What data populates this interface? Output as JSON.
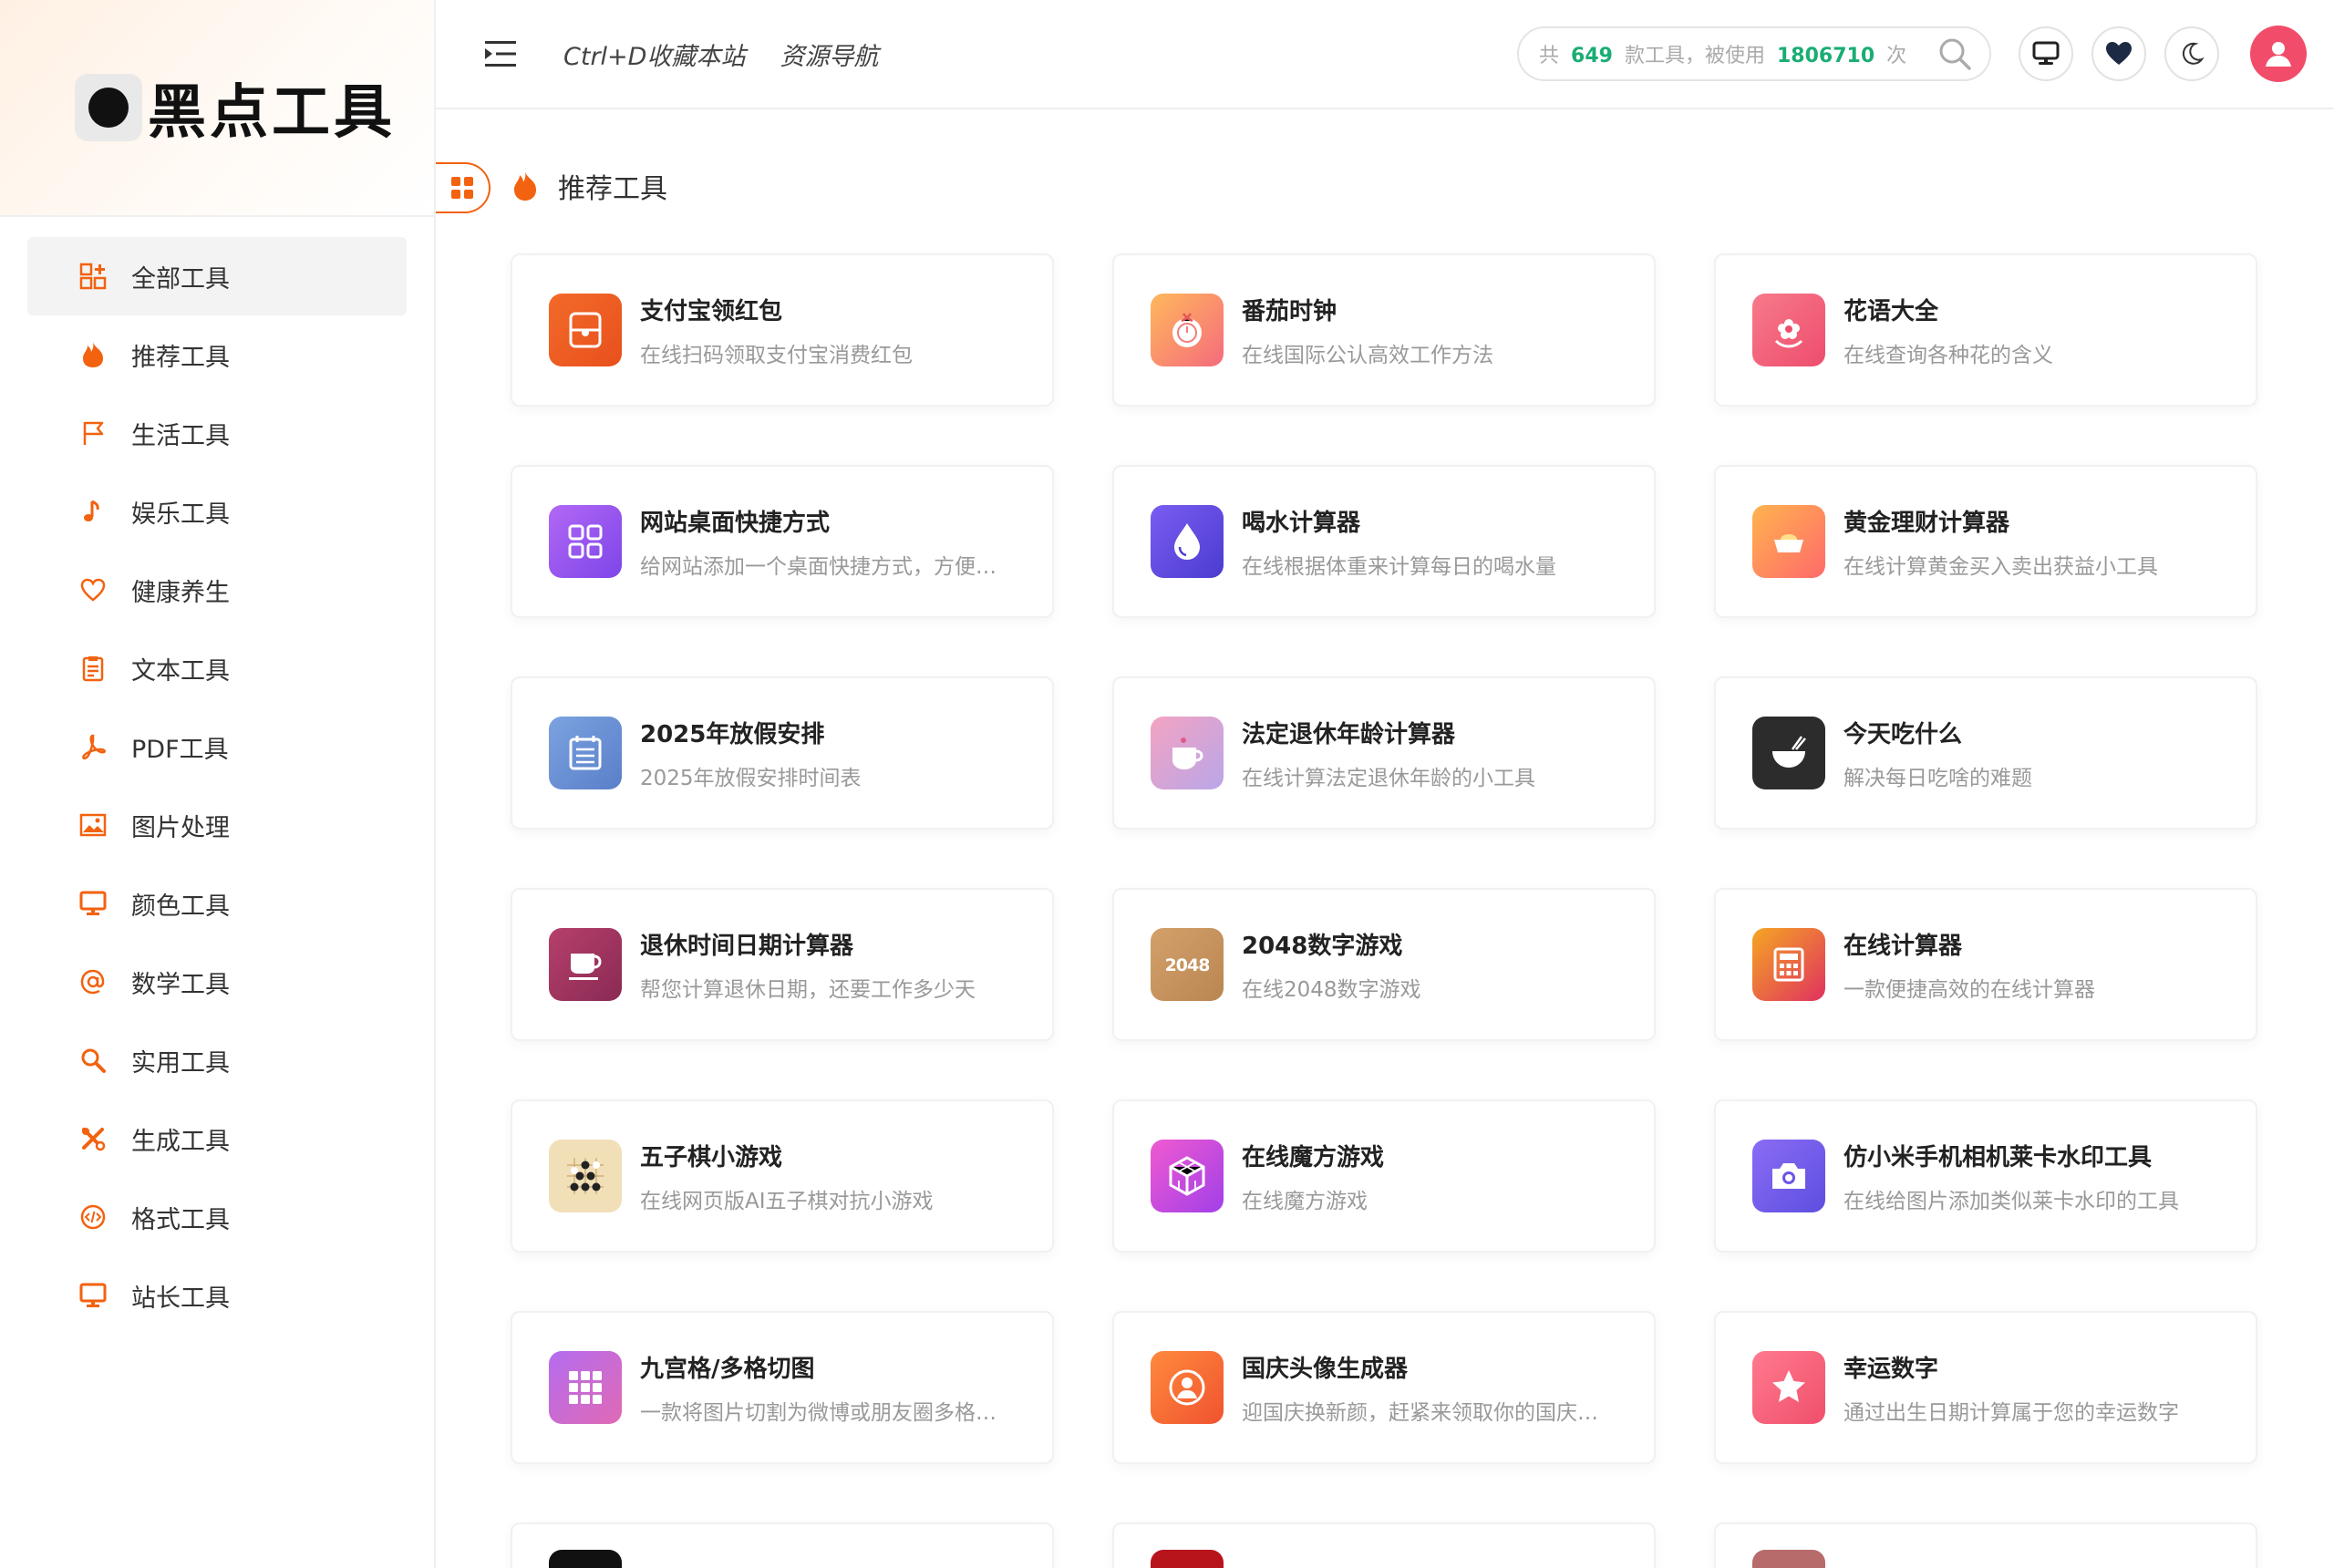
{
  "brand": {
    "name": "黑点工具"
  },
  "header": {
    "bookmark_hint": "Ctrl+D收藏本站",
    "resource_nav": "资源导航",
    "stats": {
      "prefix": "共",
      "tool_count": "649",
      "middle": "款工具，被使用",
      "use_count": "1806710",
      "suffix": "次"
    }
  },
  "sidebar": {
    "items": [
      {
        "label": "全部工具",
        "icon": "grid-plus-icon"
      },
      {
        "label": "推荐工具",
        "icon": "fire-icon"
      },
      {
        "label": "生活工具",
        "icon": "flag-icon"
      },
      {
        "label": "娱乐工具",
        "icon": "music-note-icon"
      },
      {
        "label": "健康养生",
        "icon": "heart-icon"
      },
      {
        "label": "文本工具",
        "icon": "clipboard-icon"
      },
      {
        "label": "PDF工具",
        "icon": "pdf-icon"
      },
      {
        "label": "图片处理",
        "icon": "image-icon"
      },
      {
        "label": "颜色工具",
        "icon": "monitor-icon"
      },
      {
        "label": "数学工具",
        "icon": "at-icon"
      },
      {
        "label": "实用工具",
        "icon": "magnifier-icon"
      },
      {
        "label": "生成工具",
        "icon": "tools-icon"
      },
      {
        "label": "格式工具",
        "icon": "code-icon"
      },
      {
        "label": "站长工具",
        "icon": "monitor-icon"
      }
    ]
  },
  "section": {
    "title": "推荐工具"
  },
  "tools": [
    {
      "title": "支付宝领红包",
      "desc": "在线扫码领取支付宝消费红包",
      "icon": "red-packet-icon",
      "bg": "linear-gradient(135deg,#f36a2a,#e8501c)"
    },
    {
      "title": "番茄时钟",
      "desc": "在线国际公认高效工作方法",
      "icon": "tomato-icon",
      "bg": "linear-gradient(135deg,#ffb85c,#f56b7d)"
    },
    {
      "title": "花语大全",
      "desc": "在线查询各种花的含义",
      "icon": "flower-icon",
      "bg": "linear-gradient(135deg,#f77a8a,#ee4d6d)"
    },
    {
      "title": "网站桌面快捷方式",
      "desc": "给网站添加一个桌面快捷方式，方便快速访问",
      "icon": "shortcut-icon",
      "bg": "linear-gradient(135deg,#b268f5,#7d45e8)"
    },
    {
      "title": "喝水计算器",
      "desc": "在线根据体重来计算每日的喝水量",
      "icon": "water-drop-icon",
      "bg": "linear-gradient(135deg,#7b5cf2,#4a3ccf)"
    },
    {
      "title": "黄金理财计算器",
      "desc": "在线计算黄金买入卖出获益小工具",
      "icon": "gold-icon",
      "bg": "linear-gradient(135deg,#ffb34f,#ff6a6a)"
    },
    {
      "title": "2025年放假安排",
      "desc": "2025年放假安排时间表",
      "icon": "calendar-icon",
      "bg": "linear-gradient(135deg,#7ba2e0,#5a7fc9)"
    },
    {
      "title": "法定退休年龄计算器",
      "desc": "在线计算法定退休年龄的小工具",
      "icon": "coffee-icon",
      "bg": "linear-gradient(135deg,#f4a3c2,#b9a6e8)"
    },
    {
      "title": "今天吃什么",
      "desc": "解决每日吃啥的难题",
      "icon": "bowl-icon",
      "bg": "#2c2c2c"
    },
    {
      "title": "退休时间日期计算器",
      "desc": "帮您计算退休日期，还要工作多少天",
      "icon": "cup-icon",
      "bg": "linear-gradient(135deg,#b5406b,#8a2a54)"
    },
    {
      "title": "2048数字游戏",
      "desc": "在线2048数字游戏",
      "icon": "game-2048-icon",
      "bg": "linear-gradient(135deg,#d4a06a,#b98552)"
    },
    {
      "title": "在线计算器",
      "desc": "一款便捷高效的在线计算器",
      "icon": "calculator-icon",
      "bg": "linear-gradient(135deg,#f5a623,#e0325f)"
    },
    {
      "title": "五子棋小游戏",
      "desc": "在线网页版AI五子棋对抗小游戏",
      "icon": "gomoku-icon",
      "bg": "#f1dfb8"
    },
    {
      "title": "在线魔方游戏",
      "desc": "在线魔方游戏",
      "icon": "cube-icon",
      "bg": "linear-gradient(135deg,#f05ad0,#a13fe8)"
    },
    {
      "title": "仿小米手机相机莱卡水印工具",
      "desc": "在线给图片添加类似莱卡水印的工具",
      "icon": "camera-icon",
      "bg": "linear-gradient(135deg,#8b6cf5,#5d4fe0)"
    },
    {
      "title": "九宫格/多格切图",
      "desc": "一款将图片切割为微博或朋友圈多格图片的工具",
      "icon": "nine-grid-icon",
      "bg": "linear-gradient(135deg,#b46cf0,#e06ab4)"
    },
    {
      "title": "国庆头像生成器",
      "desc": "迎国庆换新颜，赶紧来领取你的国庆头像吧",
      "icon": "avatar-frame-icon",
      "bg": "linear-gradient(135deg,#ff8a3d,#f0532f)"
    },
    {
      "title": "幸运数字",
      "desc": "通过出生日期计算属于您的幸运数字",
      "icon": "star-icon",
      "bg": "linear-gradient(135deg,#ff7a8e,#f04f6b)"
    }
  ],
  "partial_row_colors": [
    "#111111",
    "#b8141c",
    "#b86b6b"
  ],
  "colors": {
    "accent": "#f2620f",
    "stat_green": "#1aad73",
    "avatar": "#f14d6a"
  }
}
